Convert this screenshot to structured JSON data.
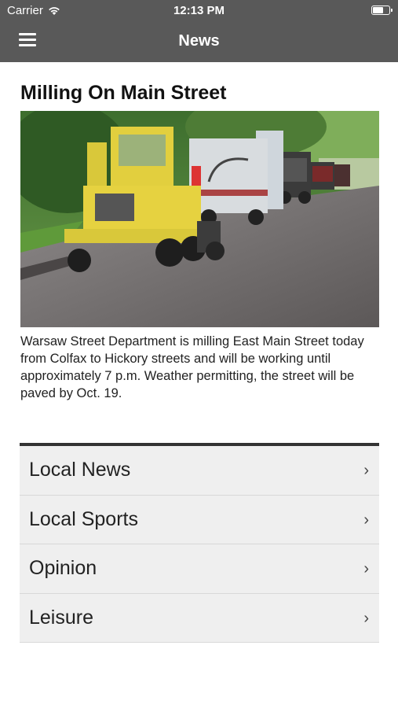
{
  "status_bar": {
    "carrier": "Carrier",
    "time": "12:13 PM",
    "wifi_icon": "wifi-icon",
    "battery_icon": "battery-icon"
  },
  "nav_bar": {
    "title": "News",
    "menu_icon": "hamburger-menu-icon",
    "background": "#595959"
  },
  "article": {
    "title": "Milling On Main Street",
    "image_alt": "road milling machinery on street",
    "body": "Warsaw Street Department is milling East Main Street today from Colfax to Hickory streets and will be working until approximately 7 p.m. Weather permitting, the street will be paved by Oct. 19."
  },
  "sections": [
    {
      "label": "Local News",
      "chevron": "›"
    },
    {
      "label": "Local Sports",
      "chevron": "›"
    },
    {
      "label": "Opinion",
      "chevron": "›"
    },
    {
      "label": "Leisure",
      "chevron": "›"
    }
  ]
}
